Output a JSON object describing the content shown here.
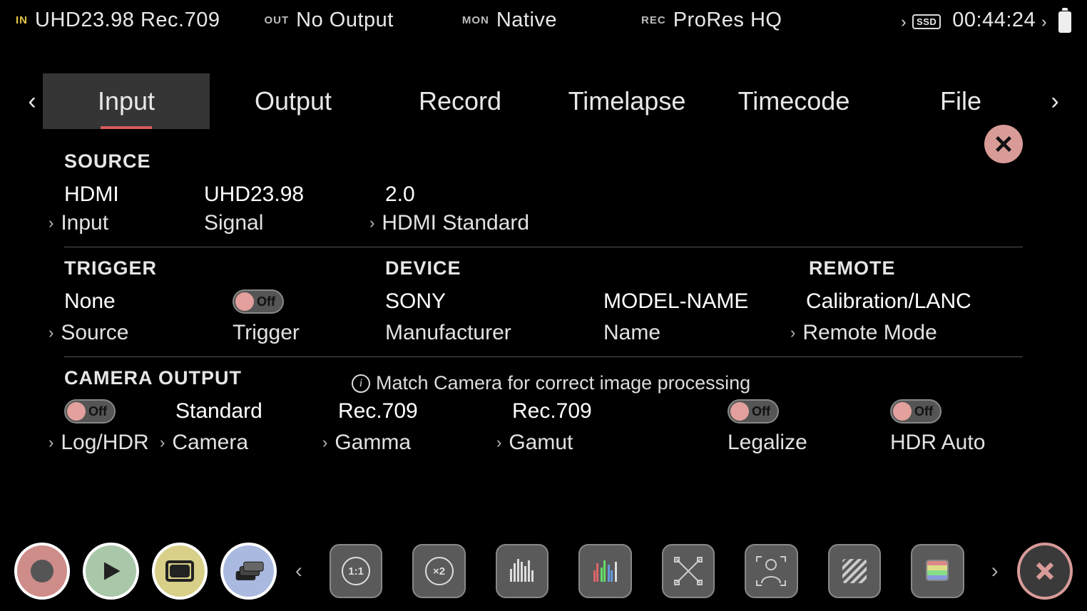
{
  "status": {
    "in": {
      "tag": "IN",
      "value": "UHD23.98  Rec.709"
    },
    "out": {
      "tag": "OUT",
      "value": "No Output"
    },
    "mon": {
      "tag": "MON",
      "value": "Native"
    },
    "rec": {
      "tag": "REC",
      "value": "ProRes HQ"
    },
    "media_kind": "SSD",
    "timecode": "00:44:24",
    "battery_pct": 100
  },
  "tabs": {
    "items": [
      "Input",
      "Output",
      "Record",
      "Timelapse",
      "Timecode",
      "File"
    ],
    "active_index": 0
  },
  "settings": {
    "source": {
      "heading": "SOURCE",
      "input_value": "HDMI",
      "signal_value": "UHD23.98",
      "hdmi_std_value": "2.0",
      "input_label": "Input",
      "signal_label": "Signal",
      "hdmi_std_label": "HDMI Standard"
    },
    "trigger": {
      "heading": "TRIGGER",
      "source_value": "None",
      "toggle_state": "Off",
      "source_label": "Source",
      "trigger_label": "Trigger"
    },
    "device": {
      "heading": "DEVICE",
      "manufacturer_value": "SONY",
      "name_value": "MODEL-NAME",
      "manufacturer_label": "Manufacturer",
      "name_label": "Name"
    },
    "remote": {
      "heading": "REMOTE",
      "mode_value": "Calibration/LANC",
      "mode_label": "Remote Mode"
    },
    "camera_output": {
      "heading": "CAMERA OUTPUT",
      "info_note": "Match Camera for correct image processing",
      "loghdr_toggle": "Off",
      "camera_value": "Standard",
      "gamma_value": "Rec.709",
      "gamut_value": "Rec.709",
      "legalize_toggle": "Off",
      "hdrauto_toggle": "Off",
      "loghdr_label": "Log/HDR",
      "camera_label": "Camera",
      "gamma_label": "Gamma",
      "gamut_label": "Gamut",
      "legalize_label": "Legalize",
      "hdrauto_label": "HDR Auto"
    }
  },
  "toolbar": {
    "zoom_1_label": "1:1",
    "zoom_2_label": "×2"
  }
}
